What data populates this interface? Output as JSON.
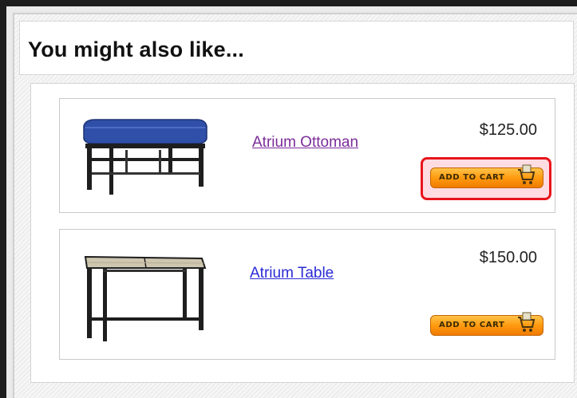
{
  "header": {
    "title": "You might also like..."
  },
  "products": [
    {
      "name": "Atrium Ottoman",
      "price": "$125.00",
      "add_to_cart_label": "ADD TO CART",
      "image_icon": "ottoman-image",
      "highlighted": true
    },
    {
      "name": "Atrium Table",
      "price": "$150.00",
      "add_to_cart_label": "ADD TO CART",
      "image_icon": "table-image",
      "highlighted": false
    }
  ],
  "colors": {
    "highlight_ring": "#e8141c",
    "button_orange": "#ff9a10",
    "visited_link": "#7b2c9a",
    "link": "#2b2bd6"
  }
}
